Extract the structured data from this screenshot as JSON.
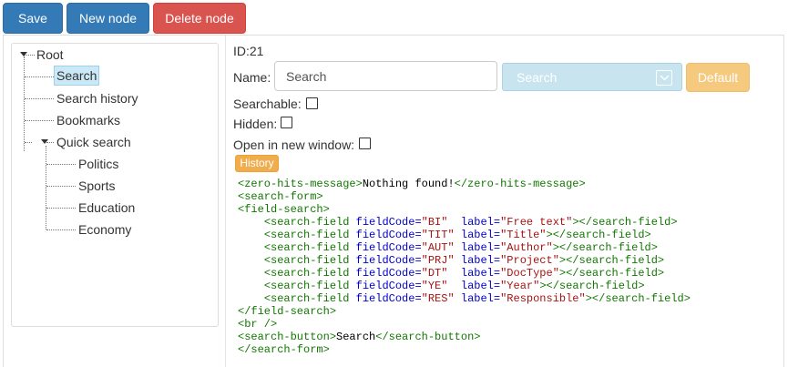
{
  "toolbar": {
    "save_label": "Save",
    "new_node_label": "New node",
    "delete_node_label": "Delete node"
  },
  "tree": {
    "root_label": "Root",
    "items": [
      {
        "label": "Search",
        "selected": true
      },
      {
        "label": "Search history"
      },
      {
        "label": "Bookmarks"
      },
      {
        "label": "Quick search",
        "children": [
          {
            "label": "Politics"
          },
          {
            "label": "Sports"
          },
          {
            "label": "Education"
          },
          {
            "label": "Economy"
          }
        ]
      }
    ]
  },
  "detail": {
    "id_label": "ID:",
    "id_value": "21",
    "name_label": "Name:",
    "name_value": "Search",
    "select_value": "Search",
    "default_label": "Default",
    "searchable_label": "Searchable:",
    "hidden_label": "Hidden:",
    "open_new_window_label": "Open in new window:",
    "history_label": "History"
  },
  "code_lines": [
    [
      [
        "tag",
        "<zero-hits-message>"
      ],
      [
        "txt",
        "Nothing found!"
      ],
      [
        "tag",
        "</zero-hits-message>"
      ]
    ],
    [
      [
        "tag",
        "<search-form>"
      ]
    ],
    [
      [
        "tag",
        "<field-search>"
      ]
    ],
    [
      [
        "txt",
        "    "
      ],
      [
        "tag",
        "<search-field "
      ],
      [
        "attr",
        "fieldCode="
      ],
      [
        "str",
        "\"BI\""
      ],
      [
        "txt",
        "  "
      ],
      [
        "attr",
        "label="
      ],
      [
        "str",
        "\"Free text\""
      ],
      [
        "tag",
        "></search-field>"
      ]
    ],
    [
      [
        "txt",
        "    "
      ],
      [
        "tag",
        "<search-field "
      ],
      [
        "attr",
        "fieldCode="
      ],
      [
        "str",
        "\"TIT\""
      ],
      [
        "txt",
        " "
      ],
      [
        "attr",
        "label="
      ],
      [
        "str",
        "\"Title\""
      ],
      [
        "tag",
        "></search-field>"
      ]
    ],
    [
      [
        "txt",
        "    "
      ],
      [
        "tag",
        "<search-field "
      ],
      [
        "attr",
        "fieldCode="
      ],
      [
        "str",
        "\"AUT\""
      ],
      [
        "txt",
        " "
      ],
      [
        "attr",
        "label="
      ],
      [
        "str",
        "\"Author\""
      ],
      [
        "tag",
        "></search-field>"
      ]
    ],
    [
      [
        "txt",
        "    "
      ],
      [
        "tag",
        "<search-field "
      ],
      [
        "attr",
        "fieldCode="
      ],
      [
        "str",
        "\"PRJ\""
      ],
      [
        "txt",
        " "
      ],
      [
        "attr",
        "label="
      ],
      [
        "str",
        "\"Project\""
      ],
      [
        "tag",
        "></search-field>"
      ]
    ],
    [
      [
        "txt",
        "    "
      ],
      [
        "tag",
        "<search-field "
      ],
      [
        "attr",
        "fieldCode="
      ],
      [
        "str",
        "\"DT\""
      ],
      [
        "txt",
        "  "
      ],
      [
        "attr",
        "label="
      ],
      [
        "str",
        "\"DocType\""
      ],
      [
        "tag",
        "></search-field>"
      ]
    ],
    [
      [
        "txt",
        "    "
      ],
      [
        "tag",
        "<search-field "
      ],
      [
        "attr",
        "fieldCode="
      ],
      [
        "str",
        "\"YE\""
      ],
      [
        "txt",
        "  "
      ],
      [
        "attr",
        "label="
      ],
      [
        "str",
        "\"Year\""
      ],
      [
        "tag",
        "></search-field>"
      ]
    ],
    [
      [
        "txt",
        "    "
      ],
      [
        "tag",
        "<search-field "
      ],
      [
        "attr",
        "fieldCode="
      ],
      [
        "str",
        "\"RES\""
      ],
      [
        "txt",
        " "
      ],
      [
        "attr",
        "label="
      ],
      [
        "str",
        "\"Responsible\""
      ],
      [
        "tag",
        "></search-field>"
      ]
    ],
    [
      [
        "tag",
        "</field-search>"
      ]
    ],
    [
      [
        "tag",
        "<br />"
      ]
    ],
    [
      [
        "tag",
        "<search-button>"
      ],
      [
        "txt",
        "Search"
      ],
      [
        "tag",
        "</search-button>"
      ]
    ],
    [
      [
        "tag",
        "</search-form>"
      ]
    ]
  ],
  "colors": {
    "primary": "#337ab7",
    "danger": "#d9534f",
    "warning": "#f0ad4e",
    "selected_node": "#cbe8f6",
    "code_tag": "#117700",
    "code_attr": "#0000cc",
    "code_string": "#aa1111"
  }
}
